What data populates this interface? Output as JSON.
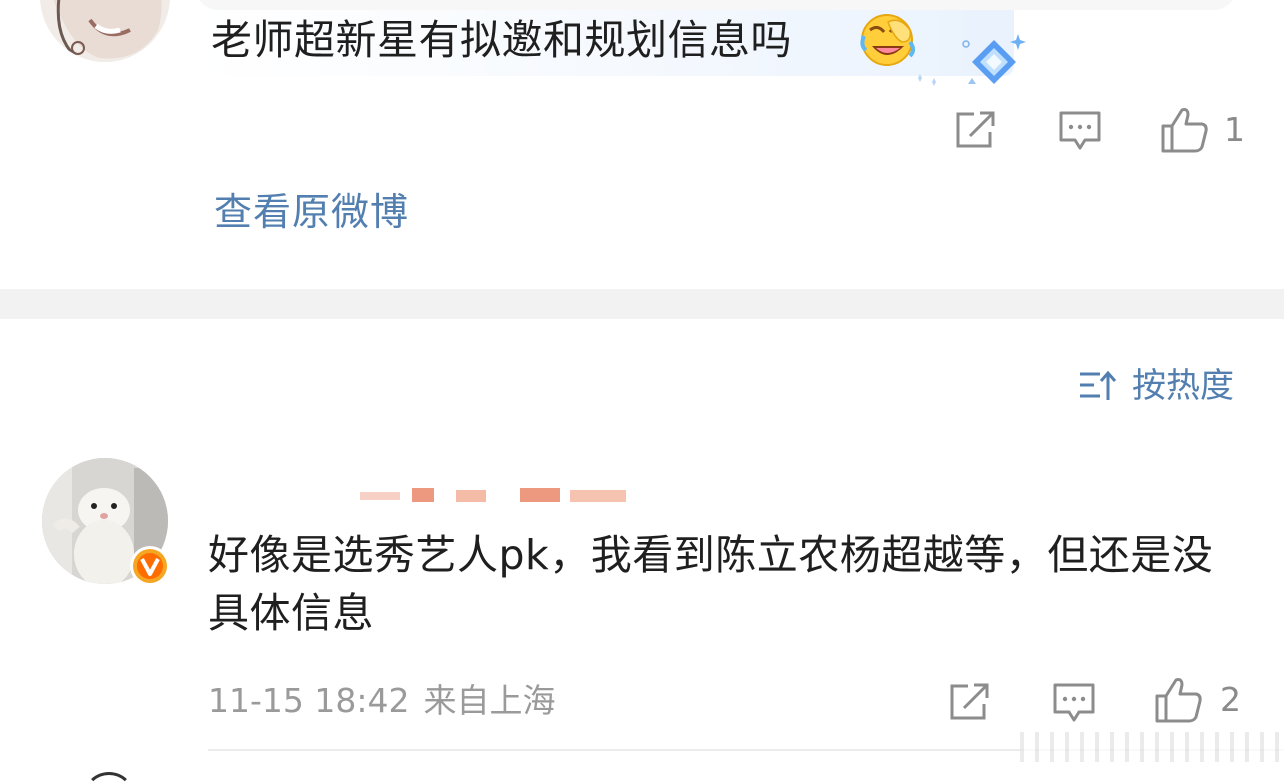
{
  "top_comment": {
    "text": "老师超新星有拟邀和规划信息吗",
    "emoji": "laugh-cry-emoji",
    "like_count": "1"
  },
  "view_original": "查看原微博",
  "sort": {
    "label": "按热度",
    "icon": "sort-icon"
  },
  "comment": {
    "text": "好像是选秀艺人pk，我看到陈立农杨超越等，但还是没具体信息",
    "date": "11-15 18:42",
    "location": "来自上海",
    "like_count": "2",
    "verified_badge": "v",
    "verified_color": "#f5a623"
  },
  "colors": {
    "link": "#527fb0",
    "text": "#1f1f1f",
    "muted": "#9a9a9a",
    "icon": "#8c8c8c",
    "divider": "#f2f2f2"
  }
}
